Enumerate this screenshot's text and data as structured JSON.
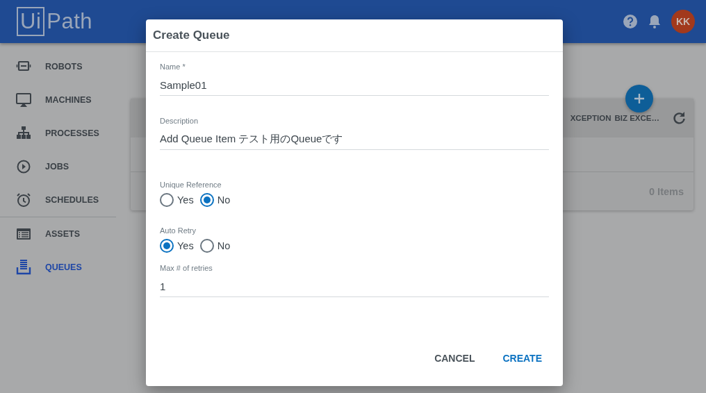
{
  "header": {
    "logo": [
      "Ui",
      "Path"
    ],
    "avatar": "KK"
  },
  "sidebar": {
    "groups": [
      {
        "items": [
          {
            "label": "ROBOTS",
            "selected": false
          },
          {
            "label": "MACHINES",
            "selected": false
          },
          {
            "label": "PROCESSES",
            "selected": false
          },
          {
            "label": "JOBS",
            "selected": false
          },
          {
            "label": "SCHEDULES",
            "selected": false
          }
        ]
      },
      {
        "items": [
          {
            "label": "ASSETS",
            "selected": false
          },
          {
            "label": "QUEUES",
            "selected": true
          }
        ]
      }
    ]
  },
  "queue_table": {
    "columns": [
      "XCEPTION",
      "BIZ EXCE…"
    ],
    "footer": "0 Items"
  },
  "dialog": {
    "title": "Create Queue",
    "fields": [
      {
        "kind": "text",
        "label": "Name *",
        "value": "Sample01"
      },
      {
        "kind": "text",
        "label": "Description",
        "value": "Add Queue Item テスト用のQueueです"
      },
      {
        "kind": "radio",
        "label": "Unique Reference",
        "options": [
          {
            "label": "Yes",
            "selected": false
          },
          {
            "label": "No",
            "selected": true
          }
        ]
      },
      {
        "kind": "radio",
        "label": "Auto Retry",
        "options": [
          {
            "label": "Yes",
            "selected": true
          },
          {
            "label": "No",
            "selected": false
          }
        ]
      },
      {
        "kind": "text",
        "label": "Max # of retries",
        "value": "1"
      }
    ],
    "buttons": [
      {
        "label": "CANCEL",
        "primary": false
      },
      {
        "label": "CREATE",
        "primary": true
      }
    ]
  }
}
